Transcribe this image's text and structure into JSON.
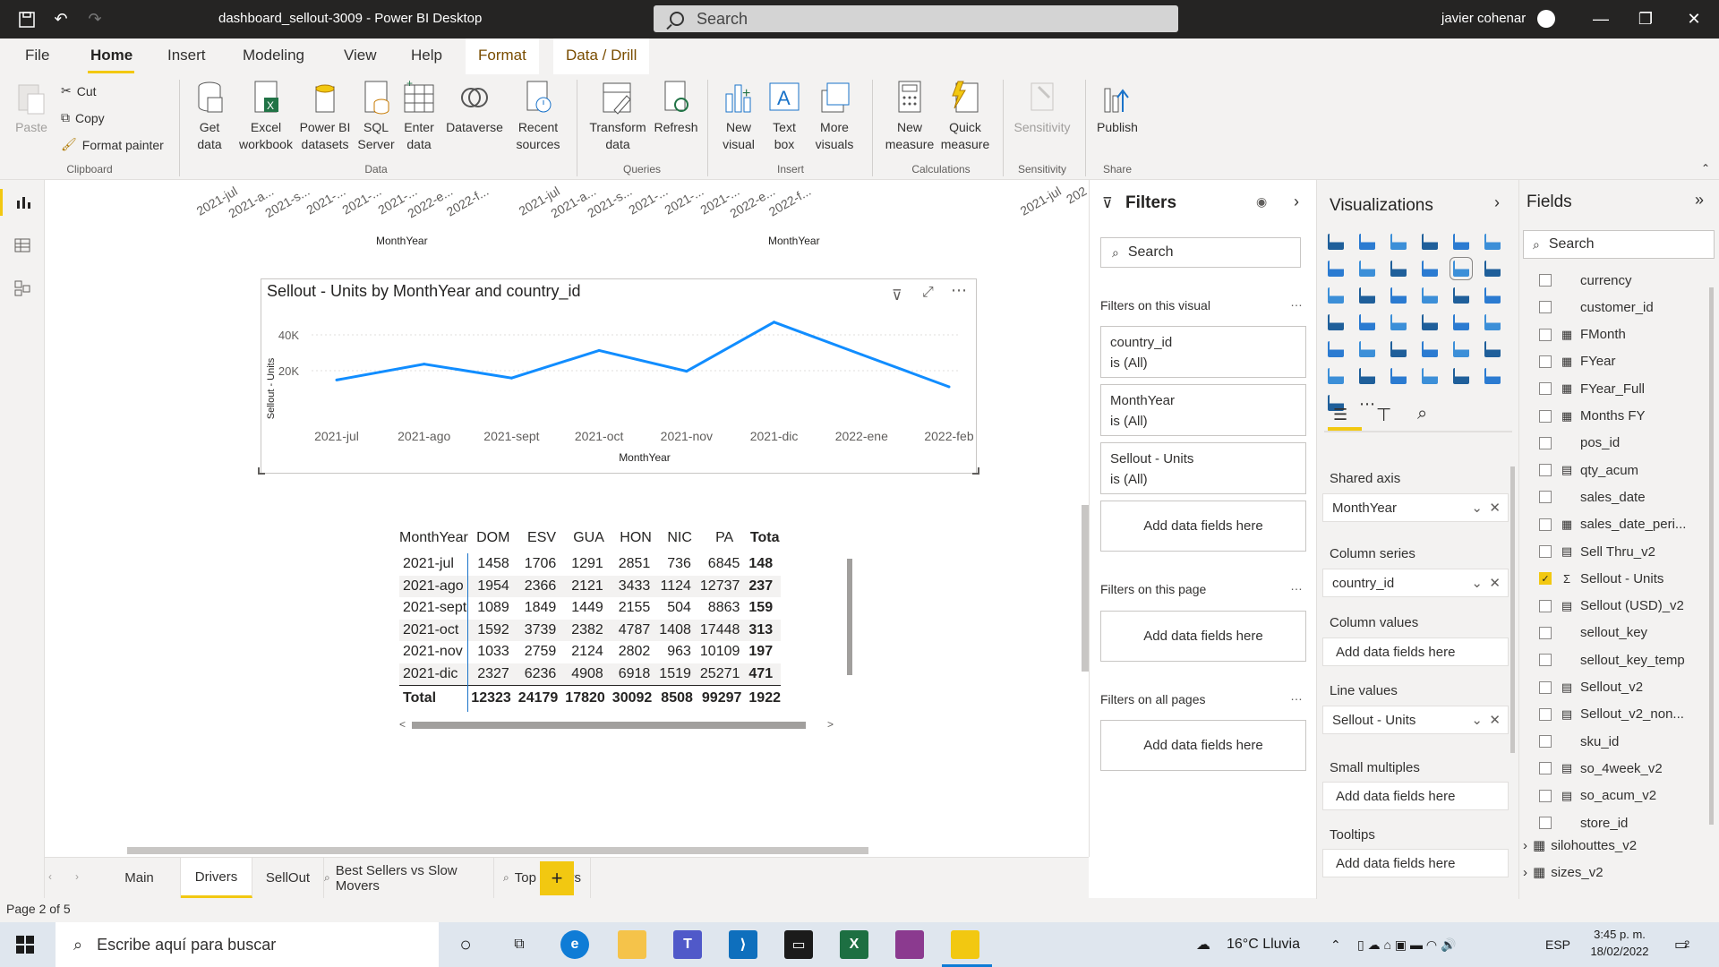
{
  "window": {
    "title": "dashboard_sellout-3009 - Power BI Desktop",
    "search_placeholder": "Search",
    "user_name": "javier cohenar"
  },
  "ribbon_tabs": [
    "File",
    "Home",
    "Insert",
    "Modeling",
    "View",
    "Help",
    "Format",
    "Data / Drill"
  ],
  "ribbon": {
    "clipboard": {
      "paste": "Paste",
      "cut": "Cut",
      "copy": "Copy",
      "format_painter": "Format painter",
      "group": "Clipboard"
    },
    "data": {
      "get_data": "Get data",
      "excel": "Excel workbook",
      "pbi_datasets": "Power BI datasets",
      "sql": "SQL Server",
      "enter_data": "Enter data",
      "dataverse": "Dataverse",
      "recent": "Recent sources",
      "group": "Data"
    },
    "queries": {
      "transform": "Transform data",
      "refresh": "Refresh",
      "group": "Queries"
    },
    "insert": {
      "new_visual": "New visual",
      "text_box": "Text box",
      "more_visuals": "More visuals",
      "group": "Insert"
    },
    "calculations": {
      "new_measure": "New measure",
      "quick_measure": "Quick measure",
      "group": "Calculations"
    },
    "sensitivity": {
      "label": "Sensitivity",
      "group": "Sensitivity"
    },
    "share": {
      "publish": "Publish",
      "group": "Share"
    }
  },
  "upper_charts": {
    "left_ticks": [
      "2021-jul",
      "2021-a...",
      "2021-s...",
      "2021-...",
      "2021-...",
      "2021-...",
      "2022-e...",
      "2022-f..."
    ],
    "mid_ticks": [
      "2021-jul",
      "2021-a...",
      "2021-s...",
      "2021-...",
      "2021-...",
      "2021-...",
      "2022-e...",
      "2022-f..."
    ],
    "right_ticks": [
      "2021-jul",
      "202"
    ],
    "axis_label": "MonthYear"
  },
  "line_visual": {
    "title": "Sellout - Units by MonthYear and country_id",
    "ylabel": "Sellout - Units",
    "xlabel": "MonthYear"
  },
  "chart_data": {
    "type": "line",
    "title": "Sellout - Units by MonthYear and country_id",
    "xlabel": "MonthYear",
    "ylabel": "Sellout - Units",
    "categories": [
      "2021-jul",
      "2021-ago",
      "2021-sept",
      "2021-oct",
      "2021-nov",
      "2021-dic",
      "2022-ene",
      "2022-feb"
    ],
    "series": [
      {
        "values": [
          14800,
          23700,
          15900,
          31300,
          19700,
          47100,
          29000,
          11000
        ]
      }
    ],
    "yticks": [
      "20K",
      "40K"
    ],
    "ylim": [
      0,
      50000
    ],
    "color": "#118dff",
    "grid": true
  },
  "table": {
    "headers": [
      "MonthYear",
      "DOM",
      "ESV",
      "GUA",
      "HON",
      "NIC",
      "PA",
      "Tota"
    ],
    "rows": [
      [
        "2021-jul",
        "1458",
        "1706",
        "1291",
        "2851",
        "736",
        "6845",
        "148"
      ],
      [
        "2021-ago",
        "1954",
        "2366",
        "2121",
        "3433",
        "1124",
        "12737",
        "237"
      ],
      [
        "2021-sept",
        "1089",
        "1849",
        "1449",
        "2155",
        "504",
        "8863",
        "159"
      ],
      [
        "2021-oct",
        "1592",
        "3739",
        "2382",
        "4787",
        "1408",
        "17448",
        "313"
      ],
      [
        "2021-nov",
        "1033",
        "2759",
        "2124",
        "2802",
        "963",
        "10109",
        "197"
      ],
      [
        "2021-dic",
        "2327",
        "6236",
        "4908",
        "6918",
        "1519",
        "25271",
        "471"
      ]
    ],
    "total": [
      "Total",
      "12323",
      "24179",
      "17820",
      "30092",
      "8508",
      "99297",
      "1922"
    ]
  },
  "page_tabs": [
    "Main",
    "Drivers",
    "SellOut",
    "Best Sellers vs Slow Movers",
    "Top Sellers"
  ],
  "status": "Page 2 of 5",
  "filters": {
    "title": "Filters",
    "search": "Search",
    "on_visual": "Filters on this visual",
    "cards": [
      {
        "name": "country_id",
        "value": "is (All)"
      },
      {
        "name": "MonthYear",
        "value": "is (All)"
      },
      {
        "name": "Sellout - Units",
        "value": "is (All)"
      }
    ],
    "add": "Add data fields here",
    "on_page": "Filters on this page",
    "on_all": "Filters on all pages"
  },
  "viz": {
    "title": "Visualizations",
    "shared_axis": "Shared axis",
    "shared_axis_val": "MonthYear",
    "column_series": "Column series",
    "column_series_val": "country_id",
    "column_values": "Column values",
    "line_values": "Line values",
    "line_values_val": "Sellout - Units",
    "small_multiples": "Small multiples",
    "tooltips": "Tooltips",
    "add": "Add data fields here"
  },
  "fields": {
    "title": "Fields",
    "search": "Search",
    "items": [
      {
        "name": "currency",
        "icon": "",
        "checked": false
      },
      {
        "name": "customer_id",
        "icon": "",
        "checked": false
      },
      {
        "name": "FMonth",
        "icon": "▦",
        "checked": false
      },
      {
        "name": "FYear",
        "icon": "▦",
        "checked": false
      },
      {
        "name": "FYear_Full",
        "icon": "▦",
        "checked": false
      },
      {
        "name": "Months FY",
        "icon": "▦",
        "checked": false
      },
      {
        "name": "pos_id",
        "icon": "",
        "checked": false
      },
      {
        "name": "qty_acum",
        "icon": "▤",
        "checked": false
      },
      {
        "name": "sales_date",
        "icon": "",
        "checked": false
      },
      {
        "name": "sales_date_peri...",
        "icon": "▦",
        "checked": false
      },
      {
        "name": "Sell Thru_v2",
        "icon": "▤",
        "checked": false
      },
      {
        "name": "Sellout - Units",
        "icon": "Σ",
        "checked": true
      },
      {
        "name": "Sellout (USD)_v2",
        "icon": "▤",
        "checked": false
      },
      {
        "name": "sellout_key",
        "icon": "",
        "checked": false
      },
      {
        "name": "sellout_key_temp",
        "icon": "",
        "checked": false
      },
      {
        "name": "Sellout_v2",
        "icon": "▤",
        "checked": false
      },
      {
        "name": "Sellout_v2_non...",
        "icon": "▤",
        "checked": false
      },
      {
        "name": "sku_id",
        "icon": "",
        "checked": false
      },
      {
        "name": "so_4week_v2",
        "icon": "▤",
        "checked": false
      },
      {
        "name": "so_acum_v2",
        "icon": "▤",
        "checked": false
      },
      {
        "name": "store_id",
        "icon": "",
        "checked": false
      }
    ],
    "tables": [
      "silohouttes_v2",
      "sizes_v2"
    ]
  },
  "taskbar": {
    "search": "Escribe aquí para buscar",
    "weather": "16°C  Lluvia",
    "lang": "ESP",
    "time": "3:45 p. m.",
    "date": "18/02/2022",
    "notif": "2"
  }
}
